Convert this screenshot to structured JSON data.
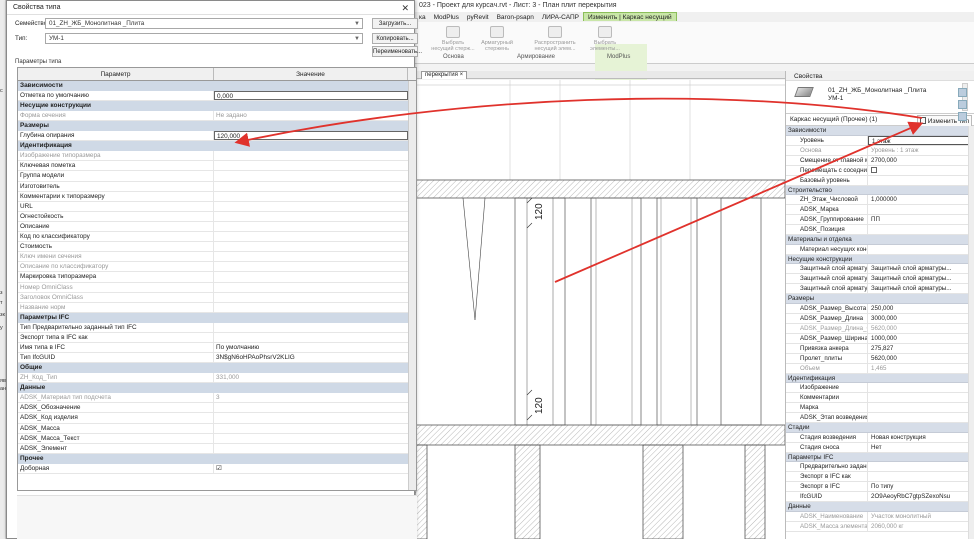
{
  "app": {
    "title_partial": "023 - Проект для курсaч.rvt - Лист: 3 - План плит перекрытия",
    "ribbon_tabs": [
      "ка",
      "ModPlus",
      "pyRevit",
      "Ваrоn-рsapn",
      "ЛИРА-САПР",
      "Изменить | Каркас несущий"
    ],
    "ribbon_buttons": [
      {
        "label": "Выбрать несущий стерж..."
      },
      {
        "label": "Арматурный стержень"
      },
      {
        "label": "Распространить несущий элем..."
      },
      {
        "label": "Выбрать элементы..."
      }
    ],
    "ribbon_groups": [
      "Основа",
      "Армирование",
      "ModPlus"
    ],
    "view_tab": "перекрытия",
    "view_tab_close": "×",
    "left_strip_marks": [
      "с",
      "з",
      "т",
      "зк",
      "у",
      "яв",
      "ан"
    ]
  },
  "canvas": {
    "dim_upper": "120",
    "dim_lower": "120"
  },
  "dialog": {
    "title": "Свойства типа",
    "close": "✕",
    "family_label": "Семейство:",
    "family_value": "01_ZH_ЖБ_Монолитная _Плита",
    "type_label": "Тип:",
    "type_value": "УМ-1",
    "load_button": "Загрузить...",
    "duplicate_button": "Копировать...",
    "rename_button": "Переименовать...",
    "type_params_label": "Параметры типа",
    "col_param": "Параметр",
    "col_value": "Значение",
    "groups": [
      {
        "name": "Зависимости",
        "rows": [
          {
            "p": "Отметка по умолчанию",
            "v": "0,000",
            "boxed": true
          }
        ]
      },
      {
        "name": "Несущие конструкции",
        "rows": [
          {
            "p": "Форма сечения",
            "v": "Не задано",
            "dis": true
          }
        ]
      },
      {
        "name": "Размеры",
        "rows": [
          {
            "p": "Глубина опирания",
            "v": "120,000",
            "boxed": true
          }
        ]
      },
      {
        "name": "Идентификация",
        "rows": [
          {
            "p": "Изображение типоразмера",
            "v": "",
            "dis": true
          },
          {
            "p": "Ключевая пометка",
            "v": ""
          },
          {
            "p": "Группа модели",
            "v": ""
          },
          {
            "p": "Изготовитель",
            "v": ""
          },
          {
            "p": "Комментарии к типоразмеру",
            "v": ""
          },
          {
            "p": "URL",
            "v": ""
          },
          {
            "p": "Огнестойкость",
            "v": ""
          },
          {
            "p": "Описание",
            "v": ""
          },
          {
            "p": "Код по классификатору",
            "v": ""
          },
          {
            "p": "Стоимость",
            "v": ""
          },
          {
            "p": "Ключ имени сечения",
            "v": "",
            "dis": true
          },
          {
            "p": "Описание по классификатору",
            "v": "",
            "dis": true
          },
          {
            "p": "Маркировка типоразмера",
            "v": ""
          },
          {
            "p": "Номер OmniClass",
            "v": "",
            "dis": true
          },
          {
            "p": "Заголовок OmniClass",
            "v": "",
            "dis": true
          },
          {
            "p": "Название норм",
            "v": "",
            "dis": true
          }
        ]
      },
      {
        "name": "Параметры IFC",
        "rows": [
          {
            "p": "Тип Предварительно заданный тип IFC",
            "v": ""
          },
          {
            "p": "Экспорт типа в IFC как",
            "v": ""
          },
          {
            "p": "Имя типа в IFC",
            "v": "По умолчанию"
          },
          {
            "p": "Тип IfcGUID",
            "v": "3N$gN6oHPAoPhsrV2KLIG"
          }
        ]
      },
      {
        "name": "Общие",
        "rows": [
          {
            "p": "ZH_Код_Тип",
            "v": "331,000",
            "dis": true
          }
        ]
      },
      {
        "name": "Данные",
        "rows": [
          {
            "p": "ADSK_Материал тип подсчета",
            "v": "3",
            "dis": true
          },
          {
            "p": "ADSK_Обозначение",
            "v": ""
          },
          {
            "p": "ADSK_Код изделия",
            "v": ""
          },
          {
            "p": "ADSK_Масса",
            "v": ""
          },
          {
            "p": "ADSK_Масса_Текст",
            "v": ""
          },
          {
            "p": "ADSK_Элемент",
            "v": ""
          }
        ]
      },
      {
        "name": "Прочее",
        "rows": [
          {
            "p": "Доборная",
            "v": "☑"
          }
        ]
      }
    ]
  },
  "properties": {
    "title": "Свойства",
    "type_line1": "01_ZH_ЖБ_Монолитная _Плита",
    "type_line2": "УМ-1",
    "selection": "Каркас несущий (Прочее) (1)",
    "edit_type_button": "Изменить тип",
    "groups": [
      {
        "name": "Зависимости",
        "rows": [
          {
            "p": "Уровень",
            "v": "1 этаж",
            "boxed": true
          },
          {
            "p": "Основа",
            "v": "Уровень : 1 этаж",
            "dis": true
          },
          {
            "p": "Смещение от главной мо...",
            "v": "2700,000"
          },
          {
            "p": "Перемещать с соседним...",
            "v": "",
            "chk": true
          },
          {
            "p": "Базовый уровень",
            "v": ""
          }
        ]
      },
      {
        "name": "Строительство",
        "rows": [
          {
            "p": "ZH_Этаж_Числовой",
            "v": "1,000000"
          },
          {
            "p": "ADSK_Марка",
            "v": ""
          },
          {
            "p": "ADSK_Группирование",
            "v": "ПП"
          },
          {
            "p": "ADSK_Позиция",
            "v": ""
          }
        ]
      },
      {
        "name": "Материалы и отделка",
        "rows": [
          {
            "p": "Материал несущих конст...",
            "v": ""
          }
        ]
      },
      {
        "name": "Несущие конструкции",
        "rows": [
          {
            "p": "Защитный слой арматур...",
            "v": "Защитный слой арматуры..."
          },
          {
            "p": "Защитный слой арматур...",
            "v": "Защитный слой арматуры..."
          },
          {
            "p": "Защитный слой арматур...",
            "v": "Защитный слой арматуры..."
          }
        ]
      },
      {
        "name": "Размеры",
        "rows": [
          {
            "p": "ADSK_Размер_Высота",
            "v": "250,000"
          },
          {
            "p": "ADSK_Размер_Длина",
            "v": "3000,000"
          },
          {
            "p": "ADSK_Размер_Длина_Спец",
            "v": "5620,000",
            "dis": true
          },
          {
            "p": "ADSK_Размер_Ширина",
            "v": "1000,000"
          },
          {
            "p": "Привязка анкера",
            "v": "275,827"
          },
          {
            "p": "Пролет_плиты",
            "v": "5620,000"
          },
          {
            "p": "Объем",
            "v": "1,465",
            "dis": true
          }
        ]
      },
      {
        "name": "Идентификация",
        "rows": [
          {
            "p": "Изображение",
            "v": ""
          },
          {
            "p": "Комментарии",
            "v": ""
          },
          {
            "p": "Марка",
            "v": ""
          },
          {
            "p": "ADSK_Этап возведения",
            "v": ""
          }
        ]
      },
      {
        "name": "Стадии",
        "rows": [
          {
            "p": "Стадия возведения",
            "v": "Новая конструкция"
          },
          {
            "p": "Стадия сноса",
            "v": "Нет"
          }
        ]
      },
      {
        "name": "Параметры IFC",
        "rows": [
          {
            "p": "Предварительно заданн...",
            "v": ""
          },
          {
            "p": "Экспорт в IFC как",
            "v": ""
          },
          {
            "p": "Экспорт в IFC",
            "v": "По типу"
          },
          {
            "p": "IfcGUID",
            "v": "2O9AeoyRbC7gtpSZexoNsu"
          }
        ]
      },
      {
        "name": "Данные",
        "rows": [
          {
            "p": "ADSK_Наименование",
            "v": "Участок монолитный",
            "dis": true
          },
          {
            "p": "ADSK_Масса элемента",
            "v": "2060,000 кг",
            "dis": true
          }
        ]
      }
    ]
  },
  "colors": {
    "arrow": "#e0322c",
    "category_bg": "#cfd9e6",
    "context_tab": "#c9e6a8"
  }
}
